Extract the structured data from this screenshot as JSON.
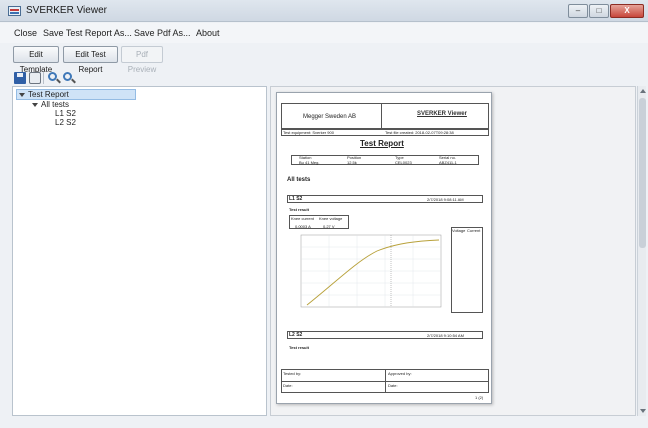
{
  "window": {
    "title": "SVERKER Viewer",
    "minimize": "–",
    "maximize": "□",
    "close": "X"
  },
  "menu": [
    "Close",
    "Save Test Report As...",
    "Save Pdf As...",
    "About"
  ],
  "toolbar": {
    "edit_template": "Edit Template",
    "edit_test_report": "Edit Test Report",
    "pdf_preview": "Pdf Preview"
  },
  "iconbar": [
    "save-icon",
    "print-icon",
    "zoom-in-icon",
    "zoom-out-icon"
  ],
  "tree": {
    "root": "Test Report",
    "group": "All tests",
    "items": [
      "L1 S2",
      "L2 S2"
    ]
  },
  "report": {
    "company": "Megger Sweden AB",
    "brand": "SVERKER Viewer",
    "equipment": "Test equipment: Sverker 900",
    "created": "Test file created: 2018-02-07T09:28:38",
    "title": "Test Report",
    "info_headers": [
      "Station",
      "Position",
      "Type",
      "Serial no."
    ],
    "info_values": [
      "Bu 41 Meg.",
      "12.5k",
      "CEL0023",
      "ABZ411-1"
    ],
    "section": "All tests",
    "test1_name": "L1 S2",
    "test1_time": "2/7/2018 9:08:11 AM",
    "test1_result": "Test result",
    "knee_headers": [
      "Knee current",
      "Knee voltage"
    ],
    "knee_values": [
      "0.0003 A",
      "0.27 V"
    ],
    "table_headers": [
      "Voltage",
      "Current"
    ],
    "test2_name": "L2 S2",
    "test2_time": "2/7/2018 9:10:54 AM",
    "test2_result": "Test result",
    "tested_by": "Tested by:",
    "approved_by": "Approved by:",
    "date1": "Date:",
    "date2": "Date:",
    "page_no": "1 (2)"
  }
}
